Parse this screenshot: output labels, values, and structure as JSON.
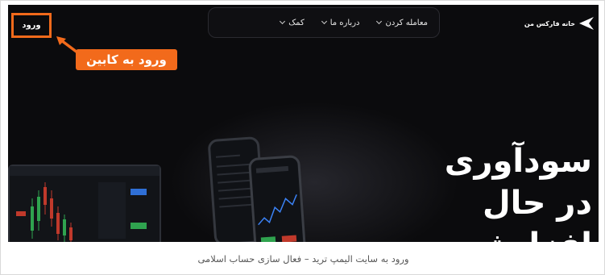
{
  "header": {
    "logo_text": "خانه فارکس من",
    "nav_items": [
      {
        "label": "معامله کردن"
      },
      {
        "label": "درباره ما"
      },
      {
        "label": "کمک"
      }
    ],
    "login_label": "ورود"
  },
  "annotation": {
    "callout_text": "ورود به کابین",
    "accent_color": "#f26a1b"
  },
  "hero": {
    "line1": "سودآوری",
    "line2": "در حال افزایش"
  },
  "caption": "ورود به سایت الیمپ ترید – فعال سازی حساب اسلامی"
}
